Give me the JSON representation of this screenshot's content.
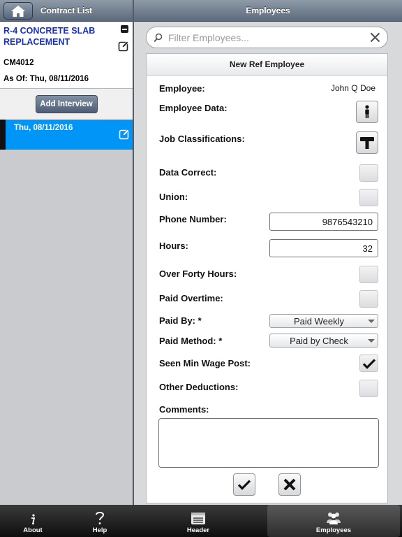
{
  "left": {
    "title": "Contract List",
    "contract": {
      "title": "R-4 CONCRETE SLAB REPLACEMENT",
      "code": "CM4012",
      "as_of": "As Of: Thu, 08/11/2016"
    },
    "add_interview_label": "Add Interview",
    "interview_date": "Thu, 08/11/2016"
  },
  "right": {
    "title": "Employees",
    "search": {
      "placeholder": "Filter Employees..."
    },
    "form_title": "New Ref Employee",
    "fields": {
      "employee_label": "Employee:",
      "employee_value": "John Q Doe",
      "employee_data_label": "Employee Data:",
      "job_class_label": "Job Classifications:",
      "data_correct_label": "Data Correct:",
      "union_label": "Union:",
      "phone_label": "Phone Number:",
      "phone_value": "9876543210",
      "hours_label": "Hours:",
      "hours_value": "32",
      "over_forty_label": "Over Forty Hours:",
      "paid_overtime_label": "Paid Overtime:",
      "paid_by_label": "Paid By: *",
      "paid_by_value": "Paid Weekly",
      "paid_method_label": "Paid Method: *",
      "paid_method_value": "Paid by Check",
      "min_wage_label": "Seen Min Wage Post:",
      "other_deductions_label": "Other Deductions:",
      "comments_label": "Comments:"
    }
  },
  "tabs": [
    {
      "label": "About",
      "icon": "info-icon"
    },
    {
      "label": "Help",
      "icon": "question-icon"
    },
    {
      "label": "Header",
      "icon": "notepad-icon"
    },
    {
      "label": "Employees",
      "icon": "people-icon"
    }
  ],
  "colors": {
    "selected_row": "#0095f7",
    "contract_title": "#1430c8",
    "toolbar": "#5b6a7c"
  }
}
